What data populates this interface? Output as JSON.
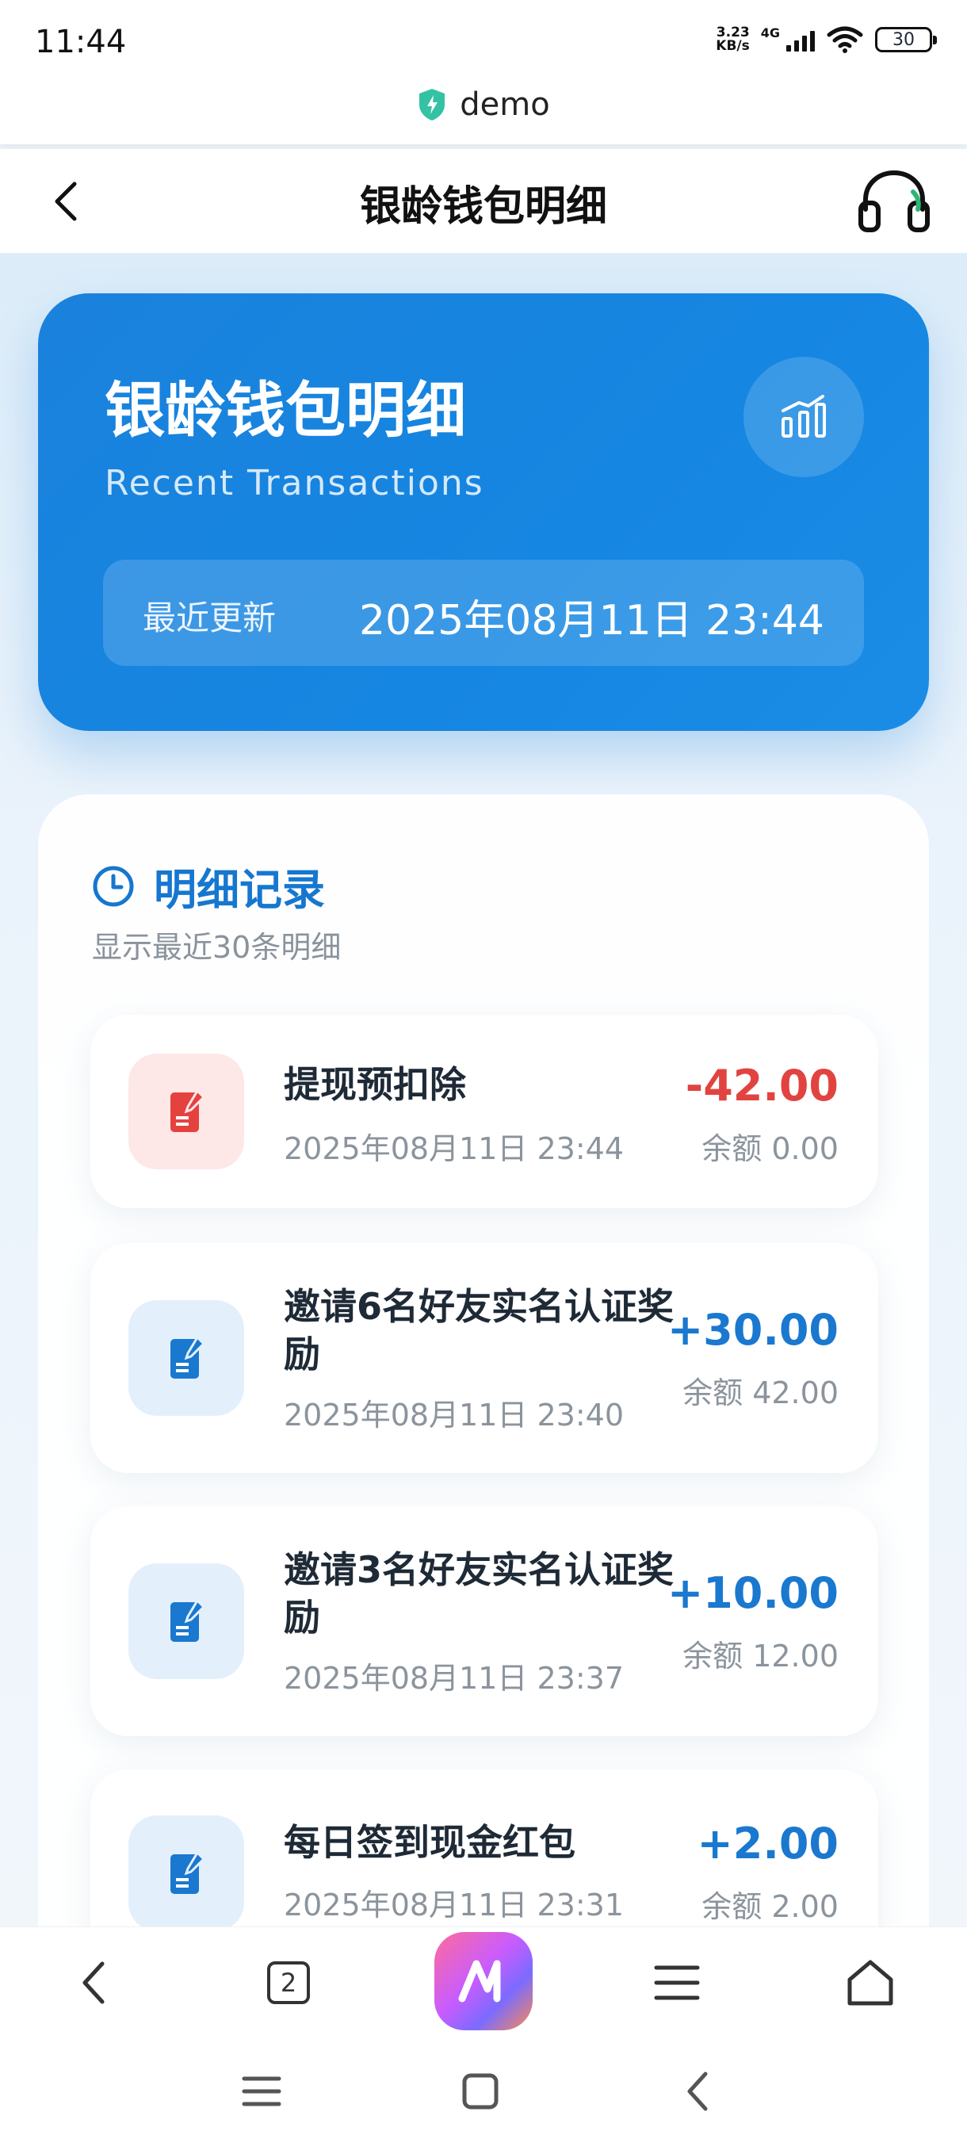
{
  "status_bar": {
    "time": "11:44",
    "net_speed_value": "3.23",
    "net_speed_unit": "KB/s",
    "network_type": "4G",
    "battery": "30"
  },
  "browser": {
    "site_name": "demo",
    "tab_count": "2"
  },
  "header": {
    "title": "银龄钱包明细"
  },
  "summary": {
    "title": "银龄钱包明细",
    "subtitle": "Recent Transactions",
    "update_label": "最近更新",
    "update_value": "2025年08月11日 23:44"
  },
  "records": {
    "title": "明细记录",
    "subtitle": "显示最近30条明细",
    "items": [
      {
        "title": "提现预扣除",
        "time": "2025年08月11日 23:44",
        "amount": "-42.00",
        "balance": "余额 0.00",
        "type": "negative"
      },
      {
        "title": "邀请6名好友实名认证奖励",
        "time": "2025年08月11日 23:40",
        "amount": "+30.00",
        "balance": "余额 42.00",
        "type": "positive"
      },
      {
        "title": "邀请3名好友实名认证奖励",
        "time": "2025年08月11日 23:37",
        "amount": "+10.00",
        "balance": "余额 12.00",
        "type": "positive"
      },
      {
        "title": "每日签到现金红包",
        "time": "2025年08月11日 23:31",
        "amount": "+2.00",
        "balance": "余额 2.00",
        "type": "positive"
      }
    ]
  },
  "colors": {
    "primary": "#1677cf",
    "negative": "#e14440",
    "card_blue": "#1586e2"
  }
}
